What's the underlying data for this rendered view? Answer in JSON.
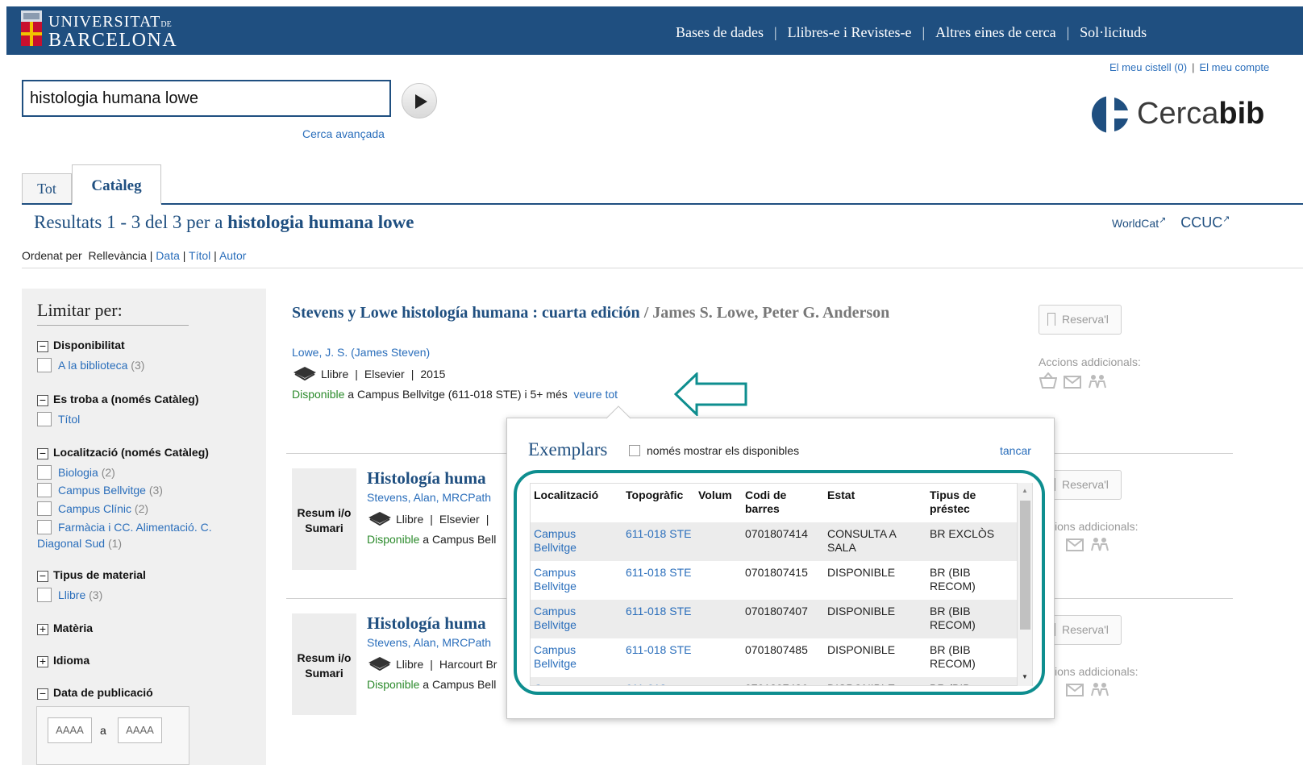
{
  "header": {
    "logo_line1": "UNIVERSITAT",
    "logo_line1_small": "DE",
    "logo_line2": "BARCELONA",
    "nav": [
      "Bases de dades",
      "Llibres-e i Revistes-e",
      "Altres eines de cerca",
      "Sol·licituds"
    ],
    "nav_separator": "|",
    "colors": {
      "bar": "#1f4f80",
      "accent": "#0e8e8f"
    }
  },
  "account": {
    "basket": "El meu cistell (0)",
    "separator": "|",
    "my_account": "El meu compte"
  },
  "search": {
    "value": "histologia humana lowe",
    "go_icon": "play-arrow-icon",
    "advanced": "Cerca avançada"
  },
  "brand": {
    "cerca": "Cerca",
    "bib": "bib"
  },
  "tabs": {
    "all": "Tot",
    "catalog": "Catàleg",
    "active": "Catàleg"
  },
  "results_heading": {
    "prefix": "Resultats 1 - 3 del 3 per a",
    "query": "histologia humana lowe"
  },
  "external": {
    "worldcat": "WorldCat",
    "ccuc": "CCUC",
    "icon": "↗"
  },
  "sort": {
    "label": "Ordenat per",
    "relevance": "Rellevància",
    "date": "Data",
    "title": "Títol",
    "author": "Autor",
    "separator": "|"
  },
  "sidebar": {
    "title": "Limitar per:",
    "facets": [
      {
        "toggle": "−",
        "label": "Disponibilitat",
        "options": [
          {
            "label": "A la biblioteca",
            "count": "(3)"
          }
        ]
      },
      {
        "toggle": "−",
        "label": "Es troba a (només Catàleg)",
        "options": [
          {
            "label": "Títol",
            "count": ""
          }
        ]
      },
      {
        "toggle": "−",
        "label": "Localització (només Catàleg)",
        "options": [
          {
            "label": "Biologia",
            "count": "(2)"
          },
          {
            "label": "Campus Bellvitge",
            "count": "(3)"
          },
          {
            "label": "Campus Clínic",
            "count": "(2)"
          },
          {
            "label": "Farmàcia i CC. Alimentació. C.",
            "label2": "Diagonal Sud",
            "count": "(1)"
          }
        ]
      },
      {
        "toggle": "−",
        "label": "Tipus de material",
        "options": [
          {
            "label": "Llibre",
            "count": "(3)"
          }
        ]
      },
      {
        "toggle": "+",
        "label": "Matèria",
        "options": []
      },
      {
        "toggle": "+",
        "label": "Idioma",
        "options": []
      },
      {
        "toggle": "−",
        "label": "Data de publicació",
        "options": []
      }
    ],
    "date_from": "AAAA",
    "date_sep": "a",
    "date_to": "AAAA"
  },
  "results": [
    {
      "title": "Stevens y Lowe histología humana : cuarta edición",
      "responsibility": " / James S. Lowe, Peter G. Anderson",
      "author": "Lowe, J. S. (James Steven)",
      "format": "Llibre",
      "publisher": "Elsevier",
      "year": "2015",
      "available": "Disponible",
      "location": " a Campus Bellvitge (611-018 STE) i 5+ més",
      "see_all": "veure tot"
    },
    {
      "summary": "Resum i/o Sumari",
      "title": "Histología huma",
      "author": "Stevens, Alan, MRCPath",
      "format": "Llibre",
      "publisher": "Elsevier",
      "pub_tail": "|",
      "available": "Disponible",
      "location": " a Campus Bell"
    },
    {
      "summary": "Resum i/o Sumari",
      "title": "Histología huma",
      "author": "Stevens, Alan, MRCPath",
      "format": "Llibre",
      "publisher": "Harcourt Br",
      "available": "Disponible",
      "location": " a Campus Bell"
    }
  ],
  "actions": {
    "reserve": "Reserva'l",
    "more": "Accions addicionals:",
    "more_clipped": "ions addicionals:",
    "icons": [
      "basket-icon",
      "mail-icon",
      "people-icon"
    ]
  },
  "holdings_popup": {
    "title": "Exemplars",
    "only_available": "només mostrar els disponibles",
    "close": "tancar",
    "columns": [
      "Localització",
      "Topogràfic",
      "Volum",
      "Codi de barres",
      "Estat",
      "Tipus de préstec"
    ],
    "rows": [
      {
        "location": "Campus Bellvitge",
        "callno": "611-018 STE",
        "volume": "",
        "barcode": "0701807414",
        "status": "CONSULTA A SALA",
        "loan": "BR EXCLÒS"
      },
      {
        "location": "Campus Bellvitge",
        "callno": "611-018 STE",
        "volume": "",
        "barcode": "0701807415",
        "status": "DISPONIBLE",
        "loan": "BR (BIB RECOM)"
      },
      {
        "location": "Campus Bellvitge",
        "callno": "611-018 STE",
        "volume": "",
        "barcode": "0701807407",
        "status": "DISPONIBLE",
        "loan": "BR (BIB RECOM)"
      },
      {
        "location": "Campus Bellvitge",
        "callno": "611-018 STE",
        "volume": "",
        "barcode": "0701807485",
        "status": "DISPONIBLE",
        "loan": "BR (BIB RECOM)"
      },
      {
        "location": "Campus",
        "callno": "611-018",
        "volume": "",
        "barcode": "0701807486",
        "status": "DISPONIBLE",
        "loan": "BR (BIB"
      }
    ]
  }
}
